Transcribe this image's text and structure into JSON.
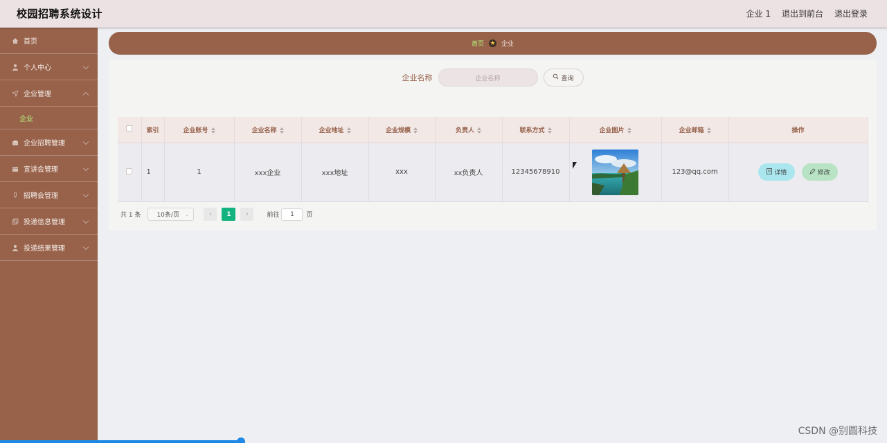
{
  "header": {
    "app_title": "校园招聘系统设计",
    "user": "企业 1",
    "to_front": "退出到前台",
    "logout": "退出登录"
  },
  "sidebar": {
    "items": [
      {
        "label": "首页",
        "icon": "home-icon"
      },
      {
        "label": "个人中心",
        "icon": "user-icon"
      },
      {
        "label": "企业管理",
        "icon": "send-icon",
        "expanded": true
      },
      {
        "label": "企业",
        "sub": true,
        "active": true
      },
      {
        "label": "企业招聘管理",
        "icon": "briefcase-icon"
      },
      {
        "label": "宣讲会管理",
        "icon": "calendar-icon"
      },
      {
        "label": "招聘会管理",
        "icon": "mic-icon"
      },
      {
        "label": "投递信息管理",
        "icon": "copy-icon"
      },
      {
        "label": "投递结果管理",
        "icon": "user-icon"
      }
    ]
  },
  "breadcrumb": {
    "home": "首页",
    "current": "企业"
  },
  "search": {
    "label": "企业名称",
    "placeholder": "企业名称",
    "button": "查询"
  },
  "table": {
    "columns": [
      "索引",
      "企业账号",
      "企业名称",
      "企业地址",
      "企业规模",
      "负责人",
      "联系方式",
      "企业图片",
      "企业邮箱",
      "操作"
    ],
    "rows": [
      {
        "index": "1",
        "account": "1",
        "name": "xxx企业",
        "address": "xxx地址",
        "scale": "xxx",
        "manager": "xx负责人",
        "phone": "12345678910",
        "email": "123@qq.com"
      }
    ],
    "actions": {
      "detail": "详情",
      "edit": "修改"
    }
  },
  "pagination": {
    "total": "共 1 条",
    "page_size": "10条/页",
    "current_page": "1",
    "goto_label": "前往",
    "goto_value": "1",
    "page_suffix": "页"
  },
  "watermark": "CSDN @别圆科技",
  "colors": {
    "sidebar": "#97614a",
    "header": "#ede2e3",
    "active_page": "#13b37f",
    "active_menu": "#b6f27a"
  }
}
